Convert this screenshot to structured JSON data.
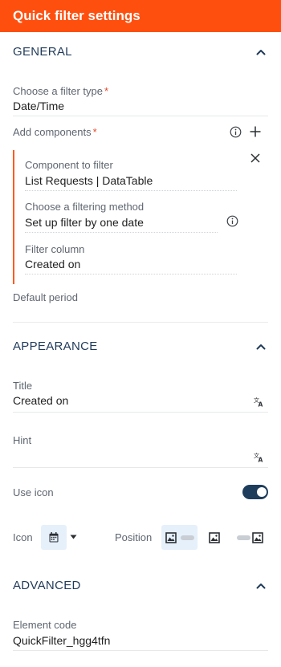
{
  "header": {
    "title": "Quick filter settings"
  },
  "general": {
    "title": "GENERAL",
    "filter_type": {
      "label": "Choose a filter type",
      "required_mark": "*",
      "value": "Date/Time"
    },
    "add_components": {
      "label": "Add components",
      "required_mark": "*"
    },
    "component": {
      "component_label": "Component to filter",
      "component_value": "List Requests | DataTable",
      "method_label": "Choose a filtering method",
      "method_value": "Set up filter by one date",
      "column_label": "Filter column",
      "column_value": "Created on"
    },
    "default_period": {
      "label": "Default period"
    }
  },
  "appearance": {
    "title": "APPEARANCE",
    "title_field": {
      "label": "Title",
      "value": "Created on"
    },
    "hint_field": {
      "label": "Hint",
      "value": ""
    },
    "use_icon": {
      "label": "Use icon",
      "enabled": true
    },
    "icon": {
      "label": "Icon",
      "selected": "calendar-icon"
    },
    "position": {
      "label": "Position",
      "options": [
        "image-left",
        "image-only",
        "image-right"
      ],
      "selected": "image-left"
    }
  },
  "advanced": {
    "title": "ADVANCED",
    "element_code": {
      "label": "Element code",
      "value": "QuickFilter_hgg4tfn"
    }
  },
  "colors": {
    "accent": "#ff4f0f",
    "section_title": "#1f3a5a",
    "toggle_on": "#1e3d5c",
    "selected_bg": "#e6f0fb"
  }
}
